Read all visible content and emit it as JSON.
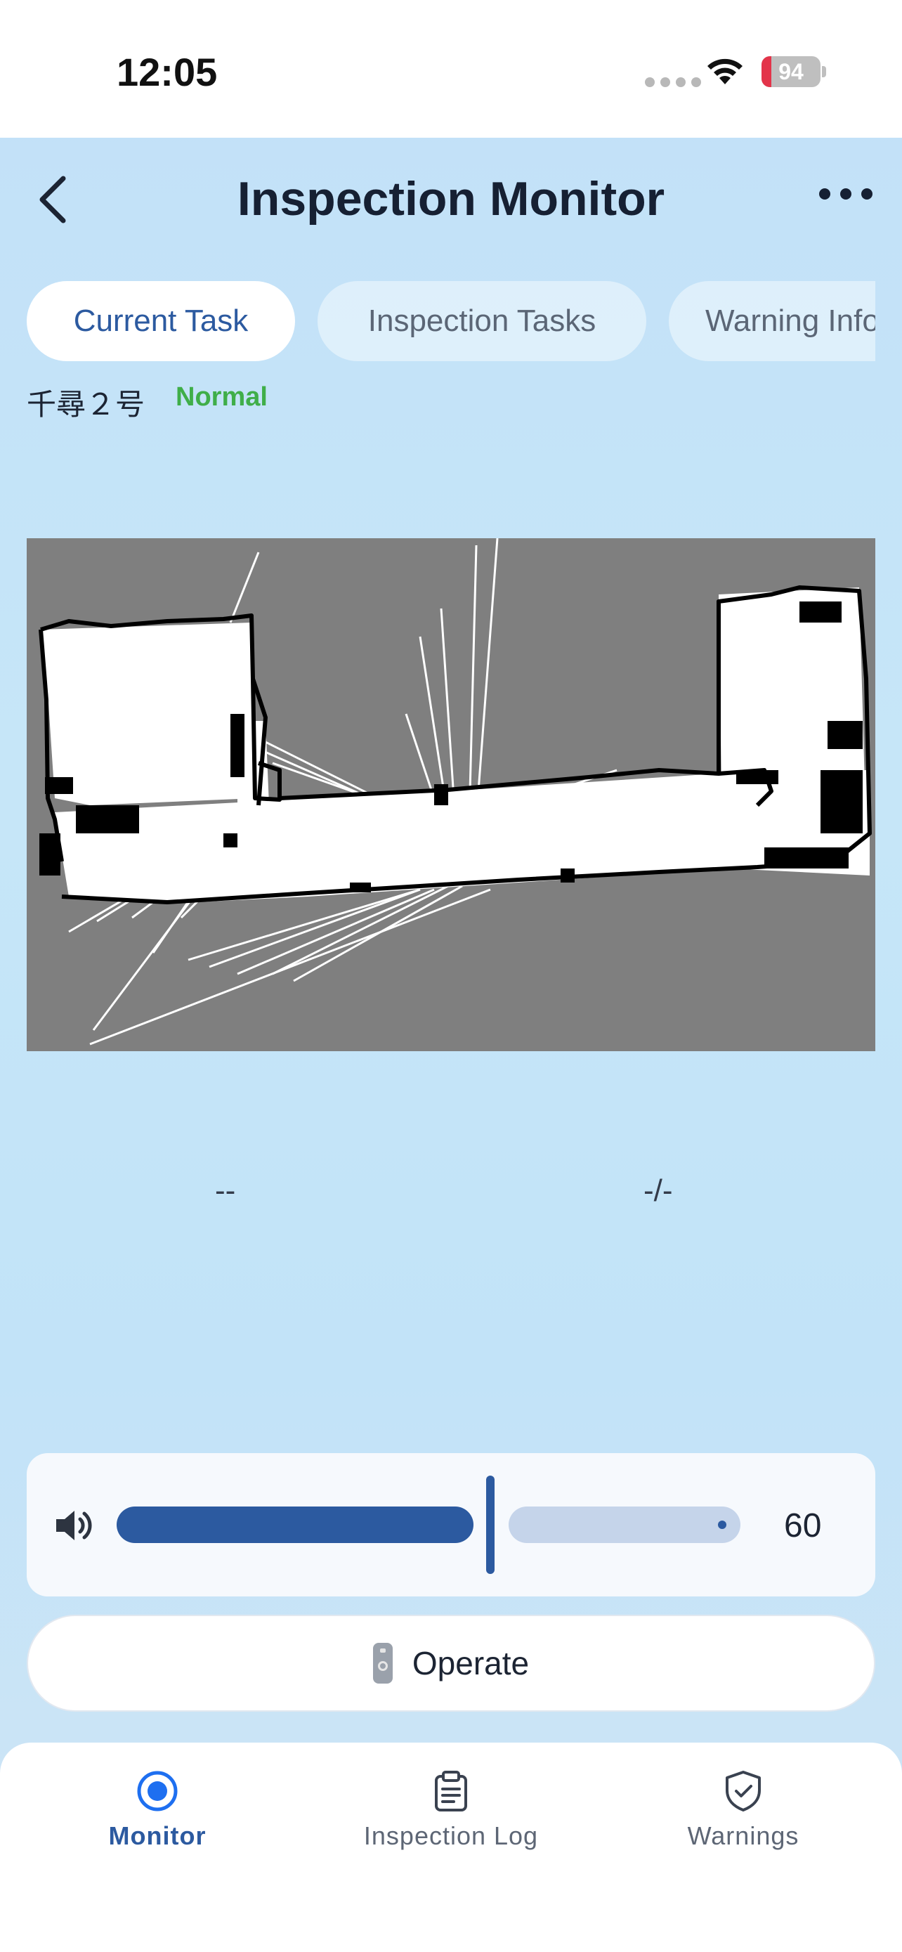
{
  "status_bar": {
    "time": "12:05",
    "battery": "94",
    "battery_color": "#e3344a"
  },
  "header": {
    "title": "Inspection Monitor",
    "back_icon": "chevron-left-icon",
    "more_icon": "more-horizontal-icon"
  },
  "tabs": [
    {
      "label": "Current Task",
      "active": true
    },
    {
      "label": "Inspection Tasks",
      "active": false
    },
    {
      "label": "Warning Info",
      "active": false
    }
  ],
  "robot": {
    "name": "千尋２号",
    "status": "Normal",
    "status_color": "#3fae49"
  },
  "map": {
    "background_color": "#7f7f7f"
  },
  "stats": {
    "left_value": "--",
    "right_value": "-/-"
  },
  "volume": {
    "icon": "speaker-icon",
    "value": "60",
    "fill_fraction": 0.6,
    "accent_color": "#2c5aa0"
  },
  "operate": {
    "label": "Operate",
    "icon": "remote-control-icon"
  },
  "bottom_nav": [
    {
      "label": "Monitor",
      "icon": "monitor-target-icon",
      "active": true
    },
    {
      "label": "Inspection Log",
      "icon": "clipboard-icon",
      "active": false
    },
    {
      "label": "Warnings",
      "icon": "shield-check-icon",
      "active": false
    }
  ]
}
